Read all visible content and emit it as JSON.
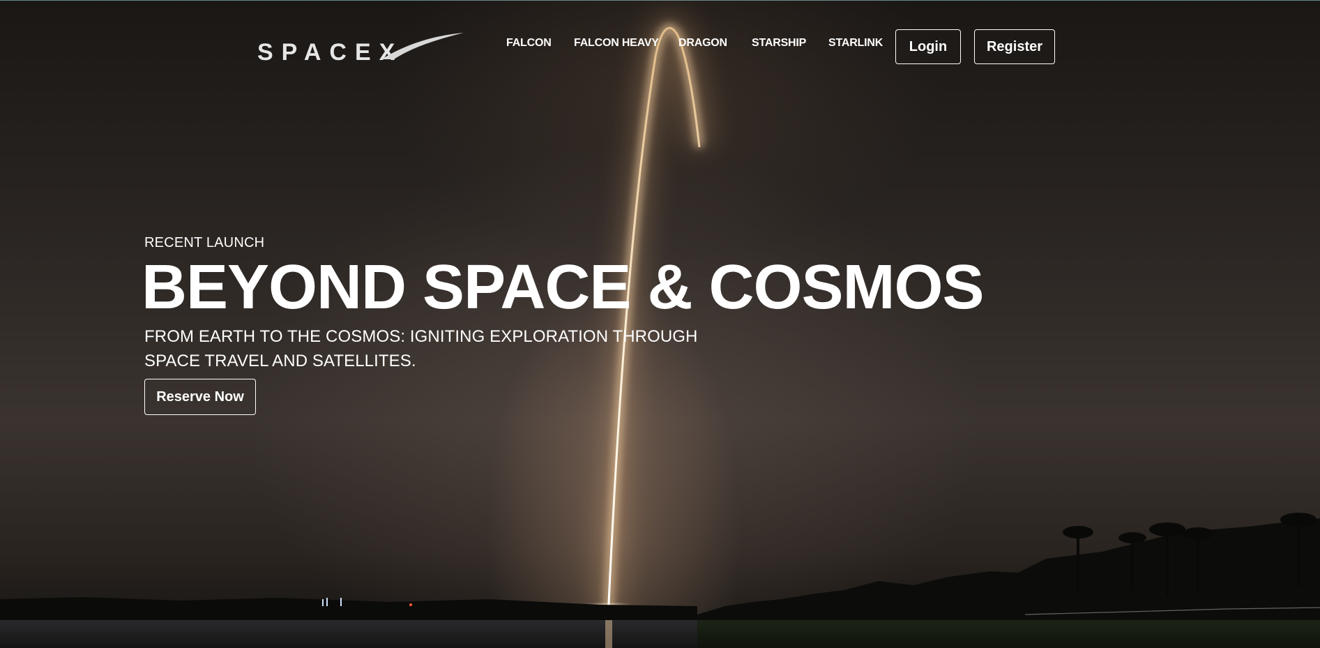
{
  "brand": {
    "logo_text": "SPACEX"
  },
  "nav": {
    "links": [
      "FALCON",
      "FALCON HEAVY",
      "DRAGON",
      "STARSHIP",
      "STARLINK"
    ],
    "login_label": "Login",
    "register_label": "Register"
  },
  "hero": {
    "eyebrow": "RECENT LAUNCH",
    "headline": "BEYOND SPACE & COSMOS",
    "subtitle": "FROM EARTH TO THE COSMOS: IGNITING EXPLORATION THROUGH SPACE TRAVEL AND SATELLITES.",
    "cta_label": "Reserve Now"
  },
  "colors": {
    "text": "#ffffff",
    "background": "#1a1715",
    "flame": "#ffd9a8"
  }
}
